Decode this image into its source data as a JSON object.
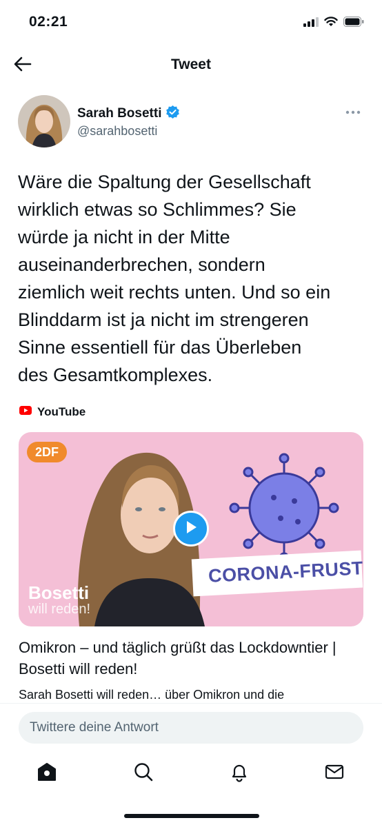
{
  "status_bar": {
    "time": "02:21"
  },
  "nav": {
    "title": "Tweet",
    "back_icon": "arrow-left-icon"
  },
  "tweet": {
    "author_name": "Sarah Bosetti",
    "author_handle": "@sarahbosetti",
    "verified": true,
    "text": "Wäre die Spaltung der Gesellschaft\nwirklich etwas so Schlimmes? Sie\nwürde ja nicht in der Mitte\nauseinanderbrechen, sondern\nziemlich weit rechts unten. Und so ein\nBlinddarm ist ja nicht im strengeren\nSinne essentiell für das Überleben\ndes Gesamtkomplexes."
  },
  "link_card": {
    "source": "YouTube",
    "thumbnail": {
      "logo": "2DF",
      "show_name": "Bosetti",
      "show_sub": "will reden!",
      "promo": "CORONA-FRUST"
    },
    "title": "Omikron – und täglich grüßt das Lockdowntier | Bosetti will reden!",
    "description": "Sarah Bosetti will reden… über Omikron und die"
  },
  "reply": {
    "placeholder": "Twittere deine Antwort"
  },
  "tabs": [
    {
      "icon": "home-icon"
    },
    {
      "icon": "search-icon"
    },
    {
      "icon": "bell-icon"
    },
    {
      "icon": "mail-icon"
    }
  ],
  "colors": {
    "accent": "#1d9bf0",
    "text": "#0f1419",
    "secondary_text": "#536471",
    "card_background": "#f4bfd6",
    "youtube_red": "#ff0000"
  }
}
